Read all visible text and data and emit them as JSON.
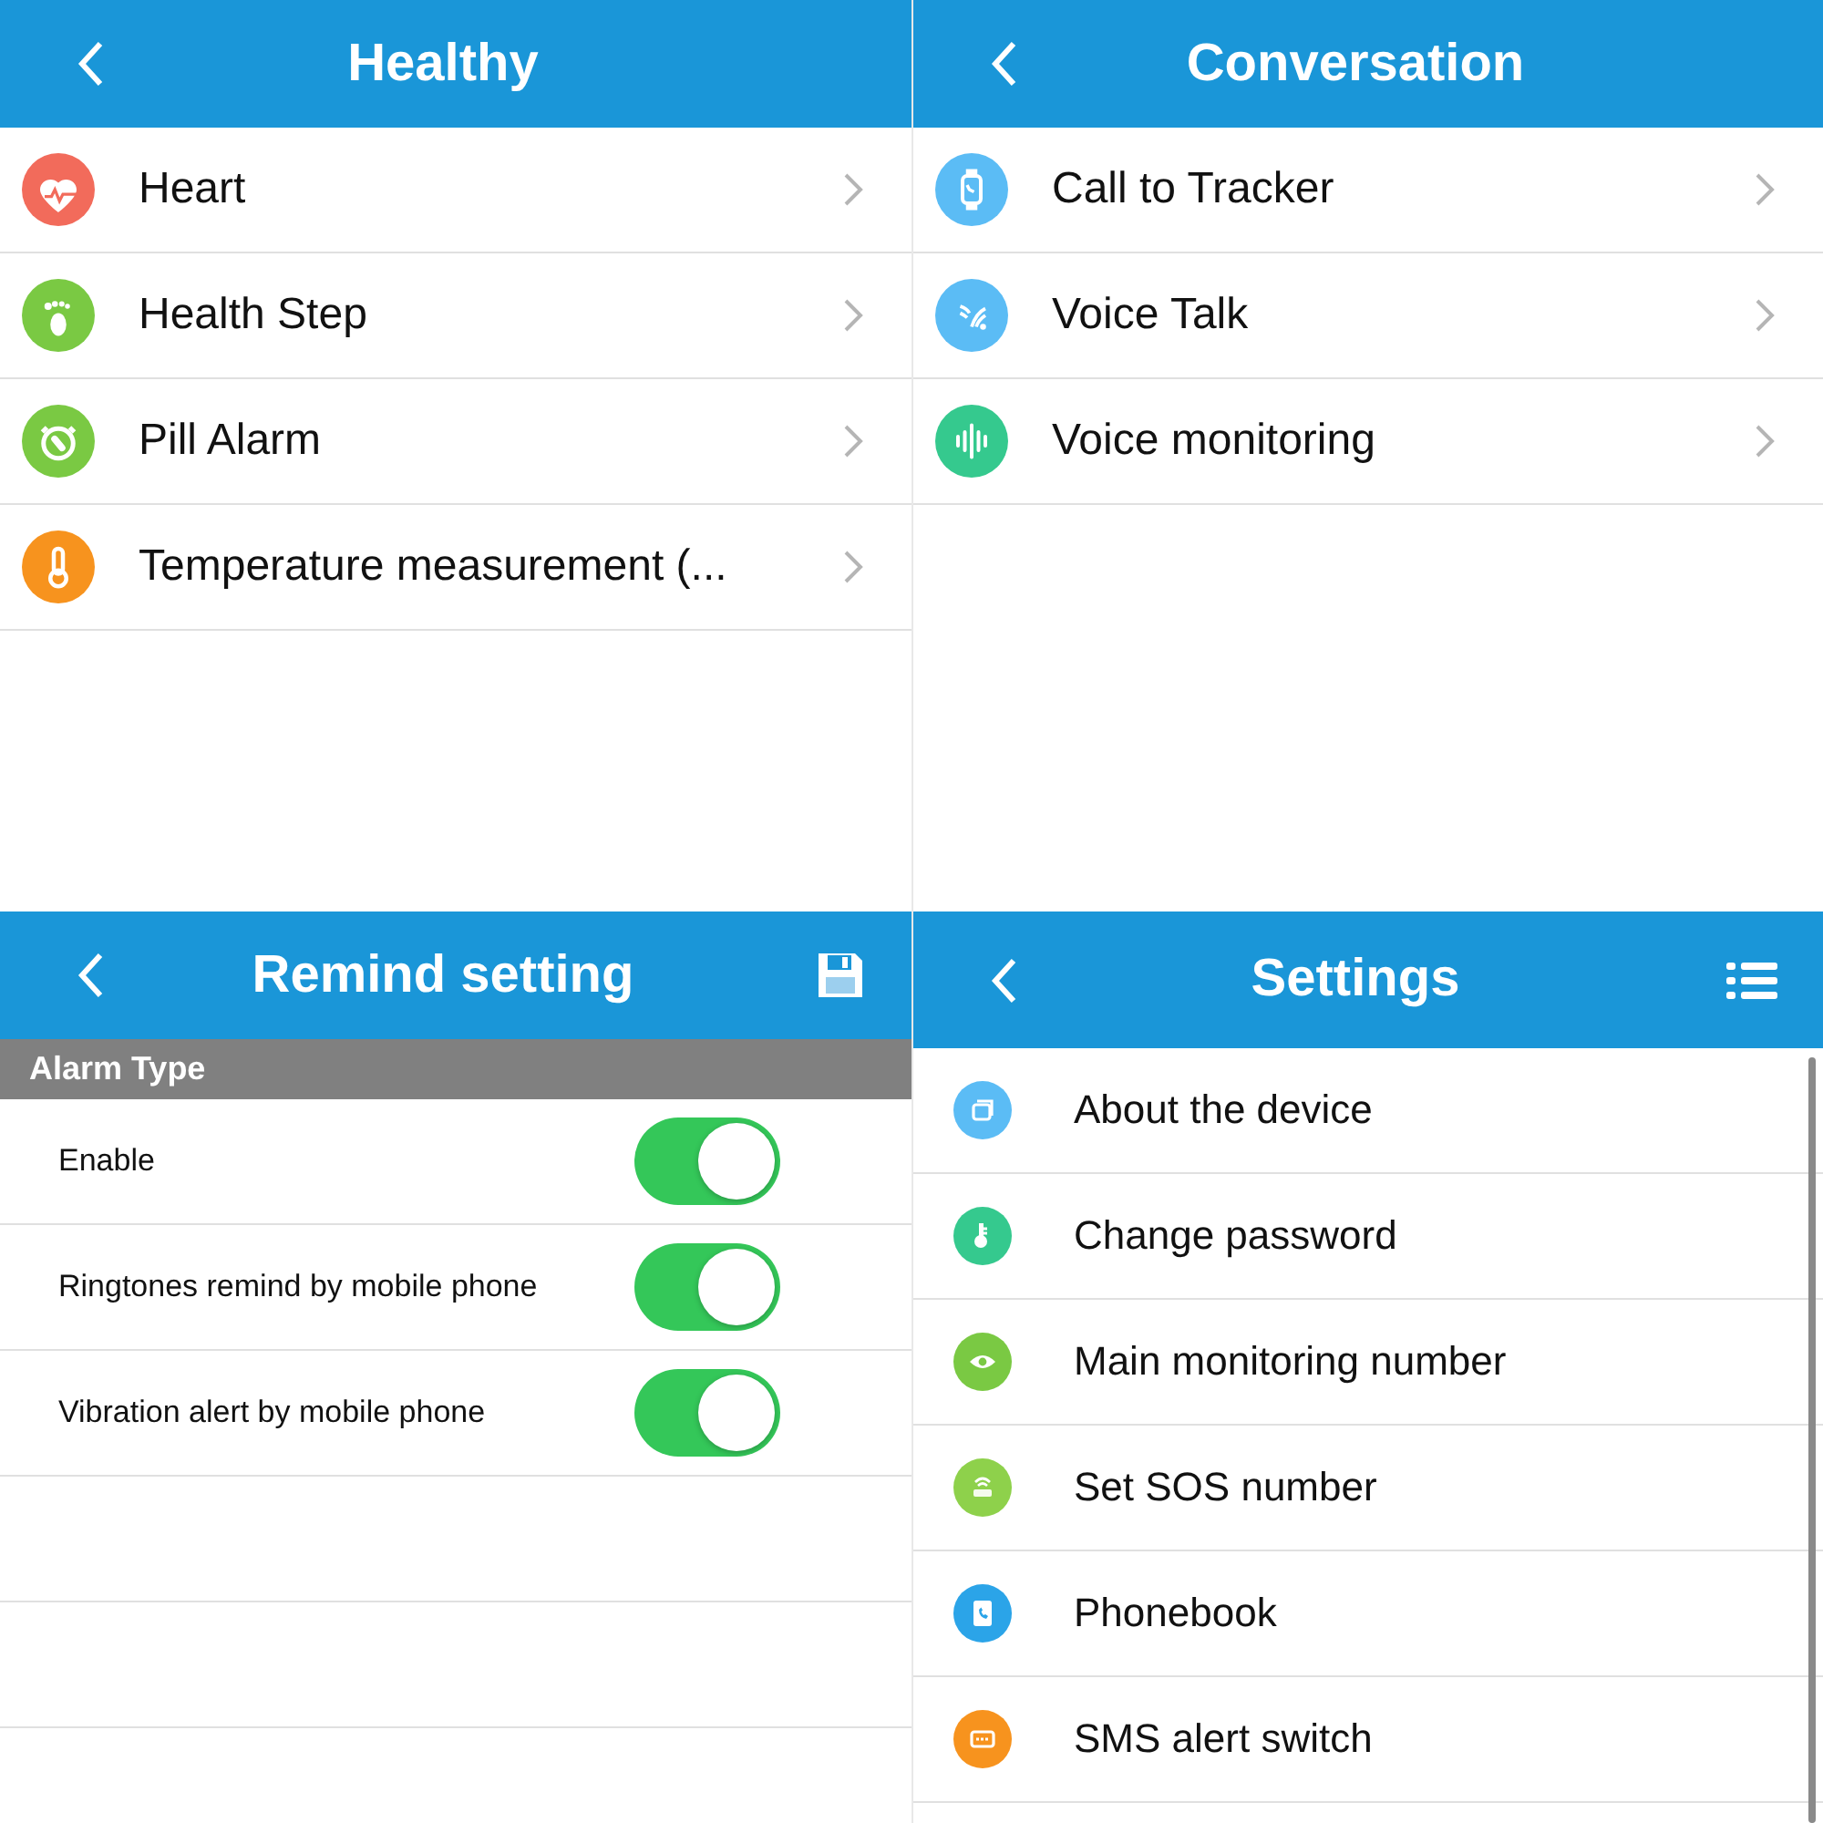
{
  "screens": [
    {
      "kind": "list",
      "title": "Healthy",
      "items": [
        {
          "label": "Heart",
          "color": "#f26b5b"
        },
        {
          "label": "Health Step",
          "color": "#7ac943"
        },
        {
          "label": "Pill Alarm",
          "color": "#7ac943"
        },
        {
          "label": "Temperature measurement (...",
          "color": "#f7931e"
        }
      ]
    },
    {
      "kind": "list",
      "title": "Conversation",
      "items": [
        {
          "label": "Call to Tracker",
          "color": "#5bbcf5"
        },
        {
          "label": "Voice Talk",
          "color": "#5bbcf5"
        },
        {
          "label": "Voice monitoring",
          "color": "#35c98e"
        }
      ]
    },
    {
      "kind": "toggles",
      "title": "Remind setting",
      "action": {
        "kind": "save"
      },
      "section": "Alarm Type",
      "rows": [
        {
          "label": "Enable",
          "on": true
        },
        {
          "label": "Ringtones remind by mobile phone",
          "on": true
        },
        {
          "label": "Vibration alert by mobile phone",
          "on": true
        }
      ]
    },
    {
      "kind": "settings",
      "title": "Settings",
      "action": {
        "kind": "menu"
      },
      "items": [
        {
          "label": "About the device",
          "color": "#5bbcf5"
        },
        {
          "label": "Change password",
          "color": "#35c98e"
        },
        {
          "label": "Main monitoring number",
          "color": "#7ac943"
        },
        {
          "label": "Set SOS number",
          "color": "#8ed14b"
        },
        {
          "label": "Phonebook",
          "color": "#2ba4e8"
        },
        {
          "label": "SMS alert switch",
          "color": "#f7931e"
        }
      ]
    }
  ]
}
